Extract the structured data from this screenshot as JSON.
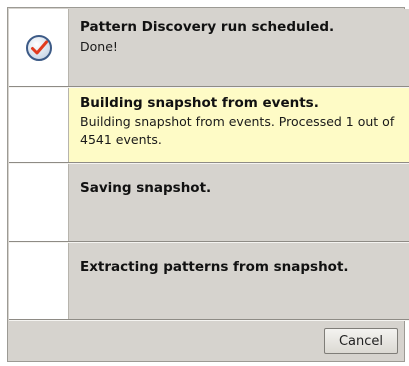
{
  "steps": [
    {
      "title": "Pattern Discovery run scheduled.",
      "detail": "Done!",
      "status": "completed",
      "icon": "check-circle-icon"
    },
    {
      "title": "Building snapshot from events.",
      "detail": "Building snapshot from events. Processed 1 out of 4541 events.",
      "status": "in-progress"
    },
    {
      "title": "Saving snapshot.",
      "detail": "",
      "status": "pending"
    },
    {
      "title": "Extracting patterns from snapshot.",
      "detail": "",
      "status": "pending"
    }
  ],
  "footer": {
    "cancel_label": "Cancel"
  },
  "colors": {
    "dialog_bg": "#d6d3ce",
    "active_row_bg": "#fefbc6",
    "check_icon_accent": "#e23b1e"
  }
}
